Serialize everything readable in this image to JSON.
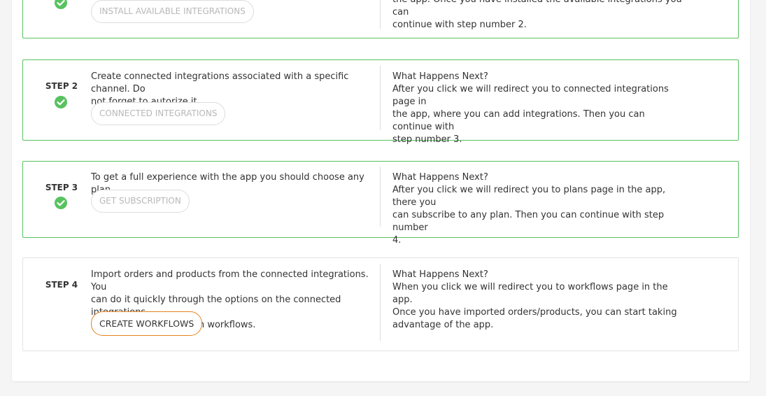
{
  "what_happens_title": "What Happens Next?",
  "steps": [
    {
      "label": "",
      "description": "",
      "button": "INSTALL AVAILABLE INTEGRATIONS",
      "next_lines": [
        "the app. Once you have installed the available integrations you can",
        "continue with step number 2."
      ],
      "completed": true
    },
    {
      "label": "STEP 2",
      "description_lines": [
        "Create connected integrations associated with a specific channel. Do",
        "not forget to autorize it."
      ],
      "button": "CONNECTED INTEGRATIONS",
      "next_lines": [
        "After you click we will redirect you to connected integrations page in",
        "the app, where you can add integrations. Then you can continue with",
        "step number 3."
      ],
      "completed": true
    },
    {
      "label": "STEP 3",
      "description_lines": [
        "To get a full experience with the app you should choose any plan."
      ],
      "button": "GET SUBSCRIPTION",
      "next_lines": [
        "After you click we will redirect you to plans page in the app, there you",
        "can subscribe to any plan. Then you can continue with step number",
        "4."
      ],
      "completed": true
    },
    {
      "label": "STEP 4",
      "description_lines": [
        "Import orders and products from the connected integrations. You",
        "can do it quickly through the options on the connected integrations",
        "cards or creating custom workflows."
      ],
      "button": "CREATE WORKFLOWS",
      "next_lines": [
        "When you click we will redirect you to workflows page in the app.",
        "Once you have imported orders/products, you can start taking",
        "advantage of the app."
      ],
      "completed": false
    }
  ],
  "colors": {
    "success": "#58c25f",
    "accent": "#e4821e",
    "disabled_text": "#b8b8b8"
  }
}
